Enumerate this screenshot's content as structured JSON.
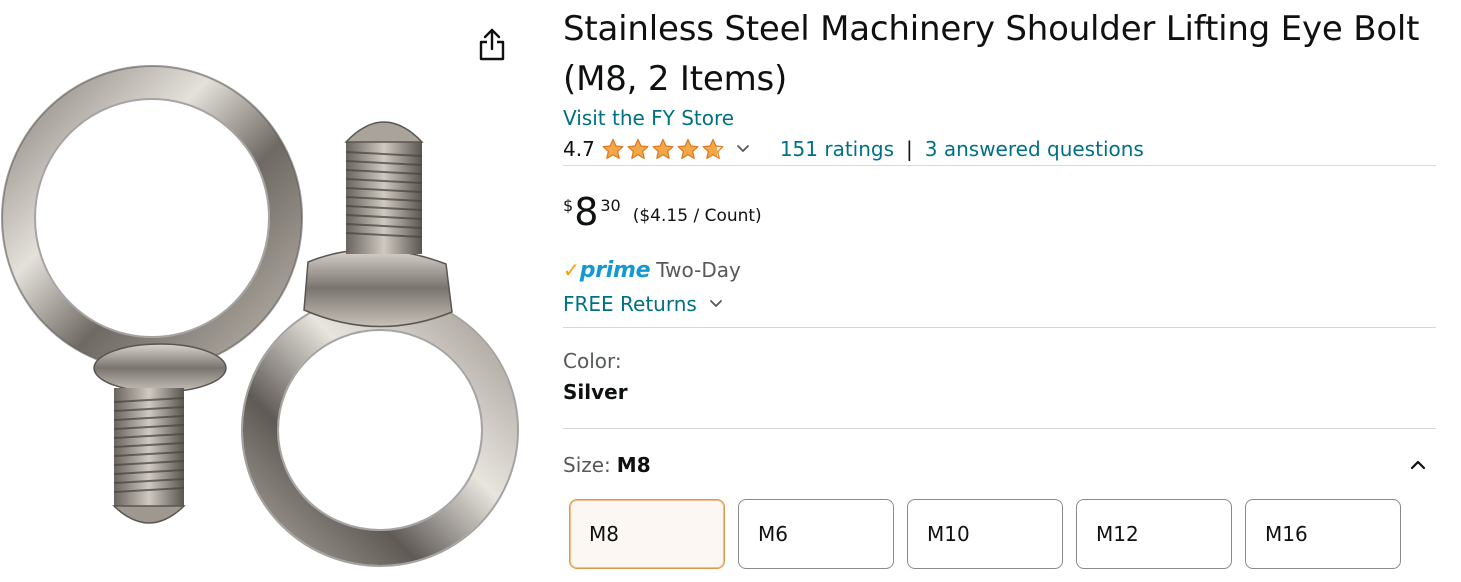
{
  "product": {
    "title": "Stainless Steel Machinery Shoulder Lifting Eye Bolt (M8, 2 Items)",
    "store_link": "Visit the FY Store",
    "rating_value": "4.7",
    "rating_stars": 4.7,
    "ratings_count": "151 ratings",
    "separator": "|",
    "answered_questions": "3 answered questions"
  },
  "price": {
    "symbol": "$",
    "whole": "8",
    "fraction": "30",
    "unit_price": "($4.15 / Count)"
  },
  "delivery": {
    "prime_check": "✓",
    "prime_word": "prime",
    "prime_speed": "Two-Day",
    "returns": "FREE Returns"
  },
  "color": {
    "label": "Color:",
    "value": "Silver"
  },
  "size": {
    "label": "Size:",
    "value": "M8",
    "options": [
      "M8",
      "M6",
      "M10",
      "M12",
      "M16"
    ]
  },
  "icons": {
    "share": "share-icon",
    "star": "star-icon",
    "chevron_down": "chevron-down-icon",
    "chevron_up": "chevron-up-icon"
  },
  "colors": {
    "link": "#007185",
    "star": "#f3a847",
    "prime_blue": "#1399d1",
    "prime_check": "#ff9900",
    "selected_border": "#d99a4a",
    "divider": "#d5d9d9"
  }
}
